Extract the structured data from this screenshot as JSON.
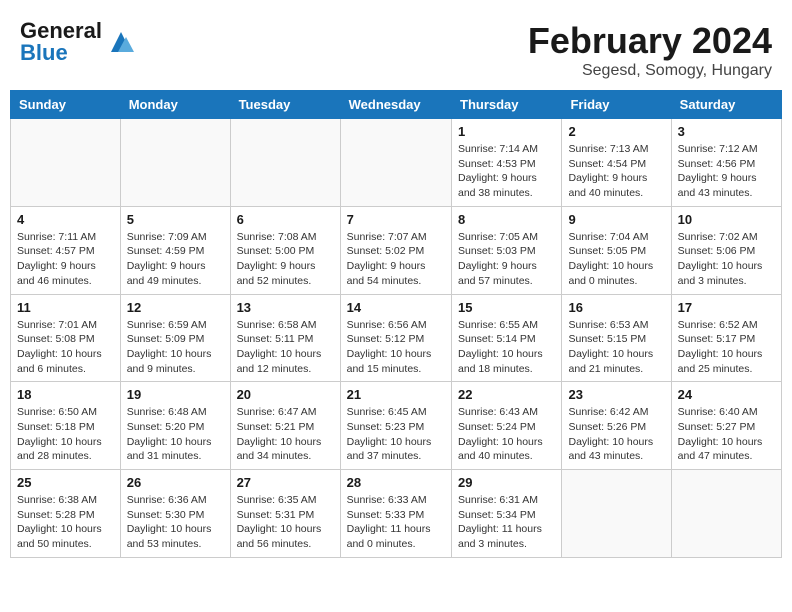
{
  "header": {
    "logo_general": "General",
    "logo_blue": "Blue",
    "title": "February 2024",
    "subtitle": "Segesd, Somogy, Hungary"
  },
  "weekdays": [
    "Sunday",
    "Monday",
    "Tuesday",
    "Wednesday",
    "Thursday",
    "Friday",
    "Saturday"
  ],
  "weeks": [
    [
      {
        "day": "",
        "info": ""
      },
      {
        "day": "",
        "info": ""
      },
      {
        "day": "",
        "info": ""
      },
      {
        "day": "",
        "info": ""
      },
      {
        "day": "1",
        "info": "Sunrise: 7:14 AM\nSunset: 4:53 PM\nDaylight: 9 hours\nand 38 minutes."
      },
      {
        "day": "2",
        "info": "Sunrise: 7:13 AM\nSunset: 4:54 PM\nDaylight: 9 hours\nand 40 minutes."
      },
      {
        "day": "3",
        "info": "Sunrise: 7:12 AM\nSunset: 4:56 PM\nDaylight: 9 hours\nand 43 minutes."
      }
    ],
    [
      {
        "day": "4",
        "info": "Sunrise: 7:11 AM\nSunset: 4:57 PM\nDaylight: 9 hours\nand 46 minutes."
      },
      {
        "day": "5",
        "info": "Sunrise: 7:09 AM\nSunset: 4:59 PM\nDaylight: 9 hours\nand 49 minutes."
      },
      {
        "day": "6",
        "info": "Sunrise: 7:08 AM\nSunset: 5:00 PM\nDaylight: 9 hours\nand 52 minutes."
      },
      {
        "day": "7",
        "info": "Sunrise: 7:07 AM\nSunset: 5:02 PM\nDaylight: 9 hours\nand 54 minutes."
      },
      {
        "day": "8",
        "info": "Sunrise: 7:05 AM\nSunset: 5:03 PM\nDaylight: 9 hours\nand 57 minutes."
      },
      {
        "day": "9",
        "info": "Sunrise: 7:04 AM\nSunset: 5:05 PM\nDaylight: 10 hours\nand 0 minutes."
      },
      {
        "day": "10",
        "info": "Sunrise: 7:02 AM\nSunset: 5:06 PM\nDaylight: 10 hours\nand 3 minutes."
      }
    ],
    [
      {
        "day": "11",
        "info": "Sunrise: 7:01 AM\nSunset: 5:08 PM\nDaylight: 10 hours\nand 6 minutes."
      },
      {
        "day": "12",
        "info": "Sunrise: 6:59 AM\nSunset: 5:09 PM\nDaylight: 10 hours\nand 9 minutes."
      },
      {
        "day": "13",
        "info": "Sunrise: 6:58 AM\nSunset: 5:11 PM\nDaylight: 10 hours\nand 12 minutes."
      },
      {
        "day": "14",
        "info": "Sunrise: 6:56 AM\nSunset: 5:12 PM\nDaylight: 10 hours\nand 15 minutes."
      },
      {
        "day": "15",
        "info": "Sunrise: 6:55 AM\nSunset: 5:14 PM\nDaylight: 10 hours\nand 18 minutes."
      },
      {
        "day": "16",
        "info": "Sunrise: 6:53 AM\nSunset: 5:15 PM\nDaylight: 10 hours\nand 21 minutes."
      },
      {
        "day": "17",
        "info": "Sunrise: 6:52 AM\nSunset: 5:17 PM\nDaylight: 10 hours\nand 25 minutes."
      }
    ],
    [
      {
        "day": "18",
        "info": "Sunrise: 6:50 AM\nSunset: 5:18 PM\nDaylight: 10 hours\nand 28 minutes."
      },
      {
        "day": "19",
        "info": "Sunrise: 6:48 AM\nSunset: 5:20 PM\nDaylight: 10 hours\nand 31 minutes."
      },
      {
        "day": "20",
        "info": "Sunrise: 6:47 AM\nSunset: 5:21 PM\nDaylight: 10 hours\nand 34 minutes."
      },
      {
        "day": "21",
        "info": "Sunrise: 6:45 AM\nSunset: 5:23 PM\nDaylight: 10 hours\nand 37 minutes."
      },
      {
        "day": "22",
        "info": "Sunrise: 6:43 AM\nSunset: 5:24 PM\nDaylight: 10 hours\nand 40 minutes."
      },
      {
        "day": "23",
        "info": "Sunrise: 6:42 AM\nSunset: 5:26 PM\nDaylight: 10 hours\nand 43 minutes."
      },
      {
        "day": "24",
        "info": "Sunrise: 6:40 AM\nSunset: 5:27 PM\nDaylight: 10 hours\nand 47 minutes."
      }
    ],
    [
      {
        "day": "25",
        "info": "Sunrise: 6:38 AM\nSunset: 5:28 PM\nDaylight: 10 hours\nand 50 minutes."
      },
      {
        "day": "26",
        "info": "Sunrise: 6:36 AM\nSunset: 5:30 PM\nDaylight: 10 hours\nand 53 minutes."
      },
      {
        "day": "27",
        "info": "Sunrise: 6:35 AM\nSunset: 5:31 PM\nDaylight: 10 hours\nand 56 minutes."
      },
      {
        "day": "28",
        "info": "Sunrise: 6:33 AM\nSunset: 5:33 PM\nDaylight: 11 hours\nand 0 minutes."
      },
      {
        "day": "29",
        "info": "Sunrise: 6:31 AM\nSunset: 5:34 PM\nDaylight: 11 hours\nand 3 minutes."
      },
      {
        "day": "",
        "info": ""
      },
      {
        "day": "",
        "info": ""
      }
    ]
  ]
}
